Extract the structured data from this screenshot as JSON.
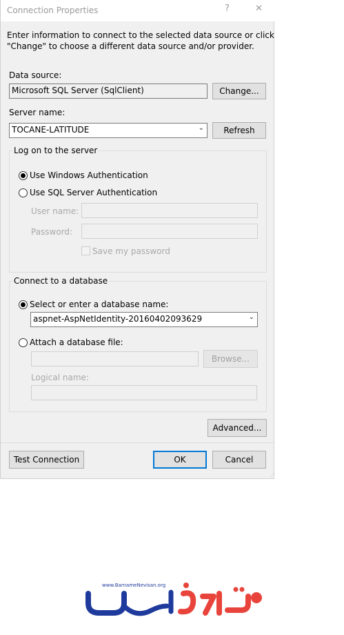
{
  "window": {
    "title": "Connection Properties",
    "help_glyph": "?",
    "close_glyph": "✕"
  },
  "intro_text_line1": "Enter information to connect to the selected data source or click",
  "intro_text_line2": "\"Change\" to choose a different data source and/or provider.",
  "data_source": {
    "label": "Data source:",
    "value": "Microsoft SQL Server (SqlClient)",
    "change_button": "Change..."
  },
  "server": {
    "label": "Server name:",
    "value": "TOCANE-LATITUDE",
    "refresh_button": "Refresh"
  },
  "logon": {
    "legend": "Log on to the server",
    "windows_auth": "Use Windows Authentication",
    "sql_auth": "Use SQL Server Authentication",
    "selected": "windows",
    "user_name_label": "User name:",
    "password_label": "Password:",
    "save_password": "Save my password"
  },
  "database": {
    "legend": "Connect to a database",
    "select_option": "Select or enter a database name:",
    "selected_db": "aspnet-AspNetIdentity-20160402093629",
    "attach_option": "Attach a database file:",
    "browse_button": "Browse...",
    "logical_name_label": "Logical name:"
  },
  "advanced_button": "Advanced...",
  "footer": {
    "test_connection": "Test Connection",
    "ok": "OK",
    "cancel": "Cancel"
  },
  "watermark": {
    "url": "www.BarnameNevisan.org"
  },
  "colors": {
    "accent": "#0078d7",
    "logo_red": "#e8443c",
    "logo_blue": "#1e3a9c"
  }
}
